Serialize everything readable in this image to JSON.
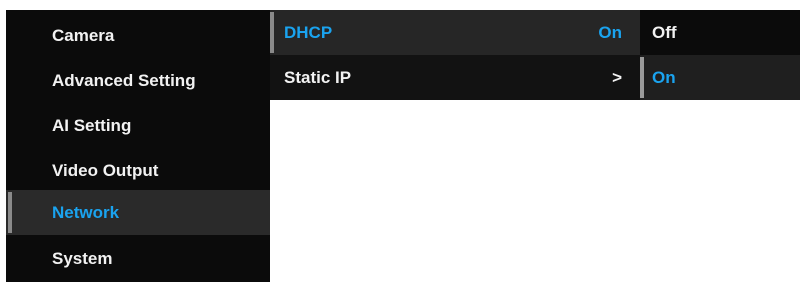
{
  "left_menu": {
    "items": [
      {
        "label": "Camera"
      },
      {
        "label": "Advanced Setting"
      },
      {
        "label": "AI Setting"
      },
      {
        "label": "Video Output"
      },
      {
        "label": "Network"
      },
      {
        "label": "System"
      }
    ],
    "active_label": "Network"
  },
  "network_menu": {
    "items": [
      {
        "label": "DHCP",
        "value": "On"
      },
      {
        "label": "Static IP",
        "value": ">"
      }
    ],
    "active_label": "DHCP"
  },
  "dhcp_options": {
    "items": [
      {
        "label": "Off"
      },
      {
        "label": "On"
      }
    ],
    "selected_label": "On"
  },
  "colors": {
    "accent": "#1aa3ef",
    "background": "#0b0b0b",
    "active_row": "#2a2a2a",
    "text": "#f2f2f2"
  }
}
